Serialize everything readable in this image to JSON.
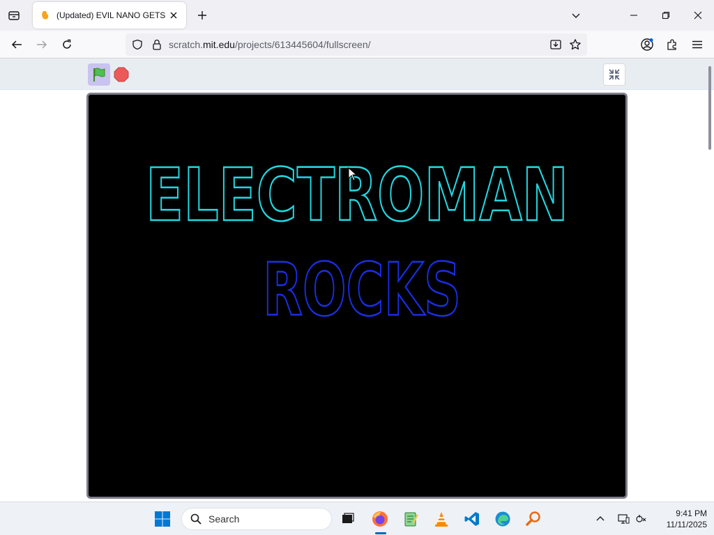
{
  "browser": {
    "tab": {
      "title": "(Updated) EVIL NANO GETS GR"
    },
    "url": {
      "prefix": "scratch.",
      "domain": "mit.edu",
      "path": "/projects/613445604/fullscreen/"
    }
  },
  "stage": {
    "line1": "ELECTROMAN",
    "line2": "ROCKS",
    "background_color": "#000000",
    "line1_color": "#22d7e0",
    "line2_color": "#1a2ee8"
  },
  "taskbar": {
    "search_label": "Search",
    "time": "9:41 PM",
    "date": "11/11/2025"
  }
}
